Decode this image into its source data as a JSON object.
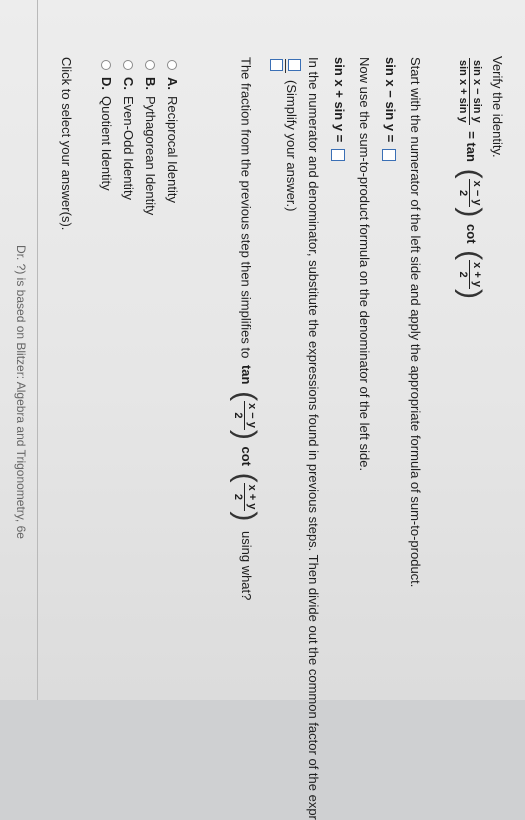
{
  "prompt": "Verify the identity.",
  "identity": {
    "lhs_num": "sin x − sin y",
    "lhs_den": "sin x + sin y",
    "equals_tan": "= tan",
    "tan_num": "x − y",
    "tan_den": "2",
    "cot": "cot",
    "cot_num": "x + y",
    "cot_den": "2"
  },
  "step1": {
    "instruction": "Start with the numerator of the left side and apply the appropriate formula of sum-to-product.",
    "expr": "sin x − sin y ="
  },
  "step2": {
    "instruction": "Now use the sum-to-product formula on the denominator of the left side.",
    "expr": "sin x + sin y ="
  },
  "step3": {
    "instruction": "In the numerator and denominator, substitute the expressions found in previous steps. Then divide out the common factor of the expr",
    "note": "(Simplify your answer.)"
  },
  "step4": {
    "pre": "The fraction from the previous step then simplifies to",
    "tan": "tan",
    "tan_num": "x − y",
    "tan_den": "2",
    "cot": "cot",
    "cot_num": "x + y",
    "cot_den": "2",
    "post": "using what?"
  },
  "options": [
    {
      "letter": "A.",
      "label": "Reciprocal Identity"
    },
    {
      "letter": "B.",
      "label": "Pythagorean Identity"
    },
    {
      "letter": "C.",
      "label": "Even-Odd Identity"
    },
    {
      "letter": "D.",
      "label": "Quotient Identity"
    }
  ],
  "click_hint": "Click to select your answer(s).",
  "footer": "Dr. ?) is based on Blitzer: Algebra and Trigonometry, 6e",
  "colors": {
    "box_border": "#3a6fb5",
    "background": "#e6e6e6"
  }
}
